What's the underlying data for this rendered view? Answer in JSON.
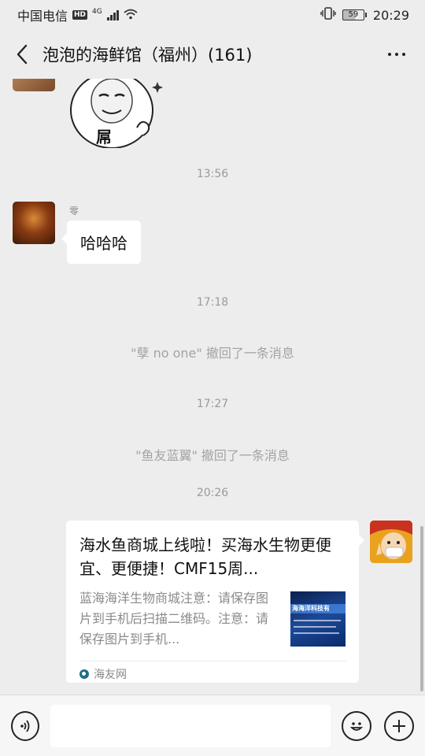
{
  "status_bar": {
    "carrier": "中国电信",
    "hd": "HD",
    "network": "4G",
    "battery": "59",
    "time": "20:29"
  },
  "header": {
    "title": "泡泡的海鲜馆（福州）(161)"
  },
  "messages": {
    "sticker_text": "屌",
    "time_1": "13:56",
    "msg_1": {
      "sender": "零",
      "text": "哈哈哈"
    },
    "time_2": "17:18",
    "recall_1": "\"孽 no one\" 撤回了一条消息",
    "time_3": "17:27",
    "recall_2": "\"鱼友蓝翼\" 撤回了一条消息",
    "time_4": "20:26",
    "link_card": {
      "title": "海水鱼商城上线啦！买海水生物更便宜、更便捷！CMF15周...",
      "description": "蓝海海洋生物商城注意：请保存图片到手机后扫描二维码。注意：请保存图片到手机...",
      "thumb_text": "海海洋科技有",
      "source": "海友网"
    }
  },
  "input_bar": {
    "input_value": ""
  },
  "icons": {
    "back": "back-arrow-icon",
    "more": "more-dots-icon",
    "voice": "voice-icon",
    "emoji": "emoji-icon",
    "plus": "plus-icon"
  }
}
